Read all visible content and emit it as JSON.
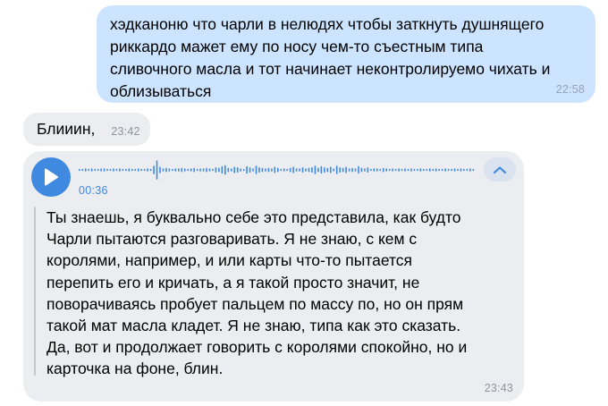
{
  "messages": [
    {
      "direction": "outgoing",
      "text": "хэдканоню что чарли в нелюдях чтобы заткнуть душнящего\nриккардо мажет ему по носу чем-то съестным типа\nсливочного масла и тот начинает неконтролируемо чихать и\nоблизываться",
      "time": "22:58"
    },
    {
      "direction": "incoming",
      "text": "Блииин,",
      "time": "23:42"
    },
    {
      "direction": "incoming",
      "type": "voice",
      "duration": "00:36",
      "transcript": "Ты знаешь, я буквально себе это представила, как будто\nЧарли пытаются разговаривать. Я не знаю, с кем с\nкоролями, например, и или карты что-то пытается\nперепить его и кричать, а я такой просто значит, не\nповорачиваясь пробует пальцем по массу по, но он прям\nтакой мат масла кладет. Я не знаю, типа как это сказать.\nДа, вот и продолжает говорить с королями спокойно, но и\nкарточка на фоне, блин.",
      "time": "23:43",
      "icons": {
        "play": "play-icon",
        "collapse": "chevron-up-icon"
      },
      "waveform": [
        2,
        2,
        3,
        2,
        3,
        2,
        2,
        3,
        3,
        2,
        2,
        3,
        2,
        3,
        2,
        2,
        3,
        2,
        2,
        3,
        2,
        2,
        3,
        2,
        8,
        18,
        6,
        3,
        4,
        3,
        2,
        3,
        3,
        4,
        3,
        2,
        3,
        4,
        2,
        3,
        3,
        4,
        3,
        2,
        5,
        4,
        7,
        9,
        4,
        3,
        6,
        5,
        3,
        2,
        7,
        5,
        3,
        8,
        5,
        4,
        3,
        4,
        3,
        6,
        4,
        2,
        3,
        2,
        4,
        6,
        3,
        3,
        5,
        3,
        4,
        5,
        8,
        4,
        7,
        5,
        4,
        6,
        3,
        8,
        5,
        4,
        6,
        3,
        4,
        3,
        7,
        4,
        3,
        5,
        2,
        3,
        3,
        2,
        4,
        3,
        2,
        3,
        2,
        3,
        2,
        3,
        2,
        3,
        2,
        2,
        3,
        2,
        2,
        3,
        2,
        3,
        2,
        2,
        3,
        2,
        2,
        3,
        2,
        3,
        2,
        2,
        3,
        2
      ]
    }
  ],
  "colors": {
    "outgoing_bg": "#cce4ff",
    "incoming_bg": "#ebedf0",
    "accent": "#3f8ae0",
    "time": "#8c96a2"
  }
}
